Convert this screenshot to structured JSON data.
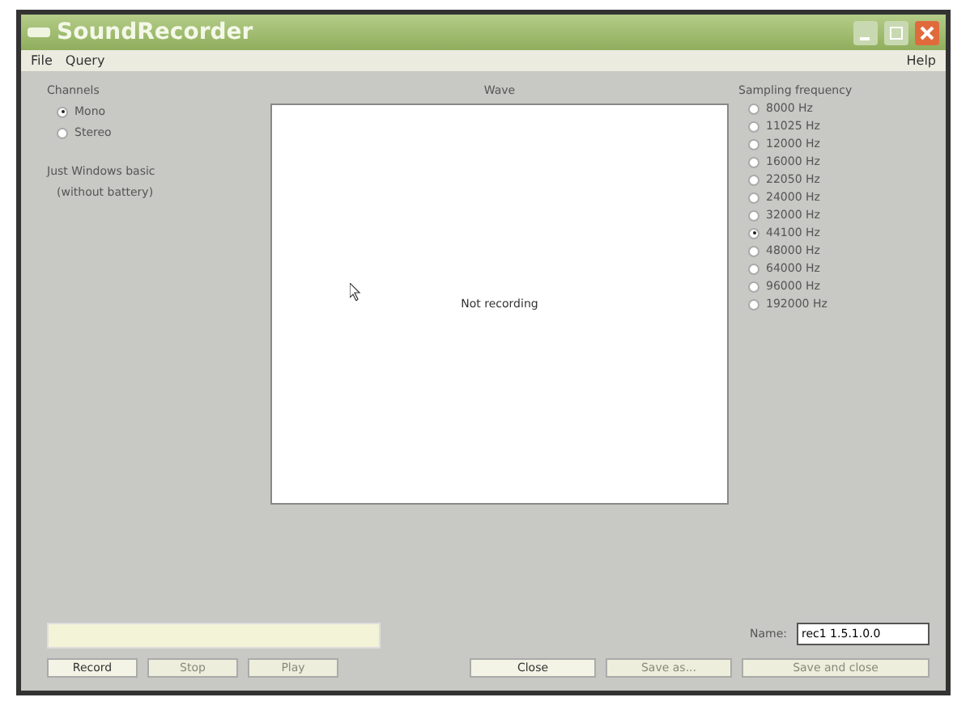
{
  "window": {
    "title": "SoundRecorder"
  },
  "menu": [
    {
      "label": "File"
    },
    {
      "label": "Query"
    },
    {
      "label": "Help"
    }
  ],
  "channels": {
    "label": "Channels",
    "options": [
      {
        "label": "Mono",
        "selected": true
      },
      {
        "label": "Stereo",
        "selected": false
      }
    ]
  },
  "notes": [
    "Just Windows basic",
    "(without battery)"
  ],
  "wave": {
    "label": "Wave",
    "status": "Not recording"
  },
  "sampling": {
    "label": "Sampling frequency",
    "options": [
      {
        "label": "8000 Hz",
        "selected": false
      },
      {
        "label": "11025 Hz",
        "selected": false
      },
      {
        "label": "12000 Hz",
        "selected": false
      },
      {
        "label": "16000 Hz",
        "selected": false
      },
      {
        "label": "22050 Hz",
        "selected": false
      },
      {
        "label": "24000 Hz",
        "selected": false
      },
      {
        "label": "32000 Hz",
        "selected": false
      },
      {
        "label": "44100 Hz",
        "selected": true
      },
      {
        "label": "48000 Hz",
        "selected": false
      },
      {
        "label": "64000 Hz",
        "selected": false
      },
      {
        "label": "96000 Hz",
        "selected": false
      },
      {
        "label": "192000 Hz",
        "selected": false
      }
    ]
  },
  "record_buttons": [
    {
      "label": "Record",
      "disabled": false
    },
    {
      "label": "Stop",
      "disabled": true
    },
    {
      "label": "Play",
      "disabled": true
    }
  ],
  "name_field": {
    "label": "Name:",
    "value": "rec1 1.5.1.0.0"
  },
  "footer_buttons": [
    {
      "label": "Close",
      "disabled": false
    },
    {
      "label": "Save as...",
      "disabled": true
    },
    {
      "label": "Save and close",
      "disabled": true
    }
  ]
}
